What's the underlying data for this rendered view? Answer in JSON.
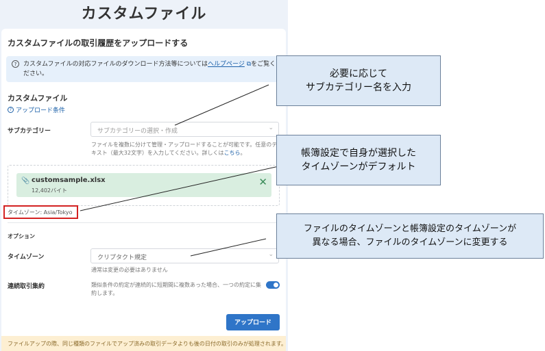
{
  "page": {
    "title": "カスタムファイル"
  },
  "panel": {
    "title": "カスタムファイルの取引履歴をアップロードする"
  },
  "info": {
    "text_before": "カスタムファイルの対応ファイルのダウンロード方法等については",
    "link": "ヘルプページ",
    "text_after": "をご覧ください。"
  },
  "custom_file": {
    "heading": "カスタムファイル",
    "conditions_link": "アップロード条件"
  },
  "subcategory": {
    "label": "サブカテゴリー",
    "placeholder": "サブカテゴリーの選択・作成",
    "help_text": "ファイルを複数に分けて管理・アップロードすることが可能です。任意のテキスト（最大32文字）を入力してください。詳しくは",
    "help_link": "こちら",
    "help_end": "。"
  },
  "file": {
    "name": "customsample.xlsx",
    "size": "12,402バイト"
  },
  "timezone_note": "タイムゾーン: Asia/Tokyo",
  "options": {
    "heading": "オプション",
    "timezone_label": "タイムゾーン",
    "timezone_value": "クリプタクト規定",
    "timezone_help": "通常は変更の必要はありません",
    "merge_label": "連続取引集約",
    "merge_help": "類似条件の約定が連続的に短期間に複数あった場合、一つの約定に集約します。",
    "merge_enabled": true
  },
  "upload_button": "アップロード",
  "notice": "ファイルアップの際、同じ種類のファイルでアップ済みの取引データよりも後の日付の取引のみが処理されます。",
  "callouts": {
    "subcategory": [
      "必要に応じて",
      "サブカテゴリー名を入力"
    ],
    "timezone_default": [
      "帳簿設定で自身が選択した",
      "タイムゾーンがデフォルト"
    ],
    "timezone_change": [
      "ファイルのタイムゾーンと帳簿設定のタイムゾーンが",
      "異なる場合、ファイルのタイムゾーンに変更する"
    ]
  },
  "colors": {
    "accent": "#2f75c8",
    "highlight": "#d32020",
    "callout_bg": "#dde9f6"
  }
}
